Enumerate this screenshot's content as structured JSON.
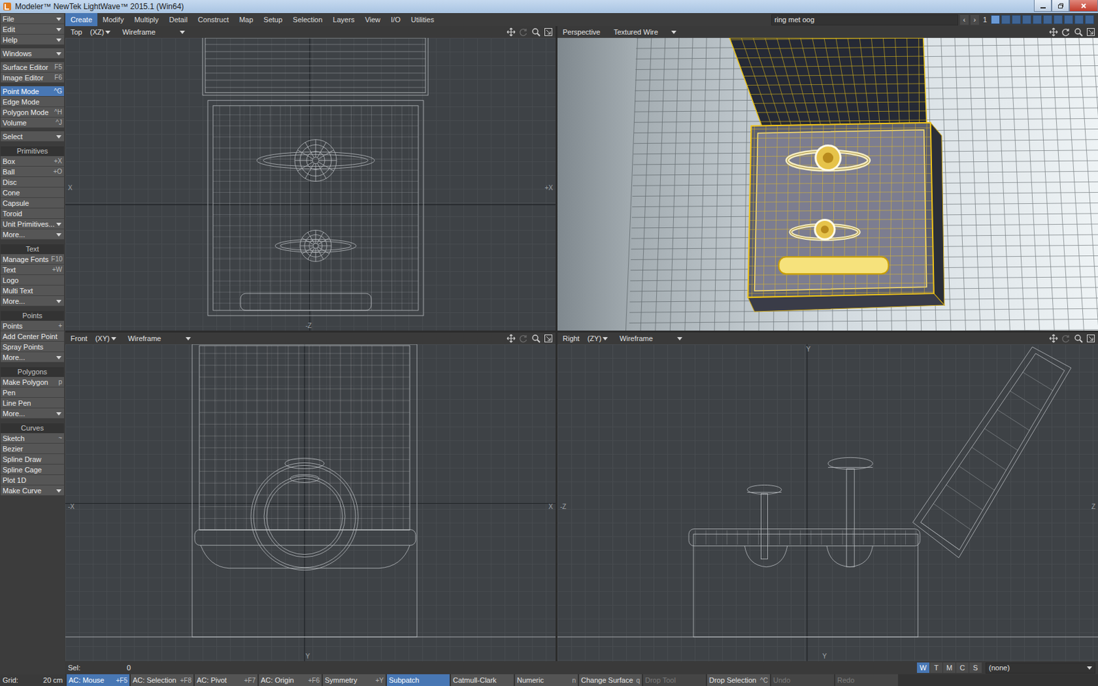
{
  "window": {
    "title": "Modeler™ NewTek LightWave™ 2015.1 (Win64)"
  },
  "tabs": [
    {
      "label": "Create",
      "selected": true
    },
    {
      "label": "Modify",
      "selected": false
    },
    {
      "label": "Multiply",
      "selected": false
    },
    {
      "label": "Detail",
      "selected": false
    },
    {
      "label": "Construct",
      "selected": false
    },
    {
      "label": "Map",
      "selected": false
    },
    {
      "label": "Setup",
      "selected": false
    },
    {
      "label": "Selection",
      "selected": false
    },
    {
      "label": "Layers",
      "selected": false
    },
    {
      "label": "View",
      "selected": false
    },
    {
      "label": "I/O",
      "selected": false
    },
    {
      "label": "Utilities",
      "selected": false
    }
  ],
  "object": {
    "name": "ring met oog",
    "prev": "‹",
    "next": "›",
    "layer": "1",
    "layers": [
      {
        "selected": true
      },
      {
        "selected": false
      },
      {
        "selected": false
      },
      {
        "selected": false
      },
      {
        "selected": false
      },
      {
        "selected": false
      },
      {
        "selected": false
      },
      {
        "selected": false
      },
      {
        "selected": false
      },
      {
        "selected": false
      }
    ]
  },
  "sidebar": {
    "groups": [
      {
        "title": "",
        "items": [
          {
            "label": "File",
            "shortcut": "",
            "kind": "dropdown",
            "selected": false
          },
          {
            "label": "Edit",
            "shortcut": "",
            "kind": "dropdown",
            "selected": false
          },
          {
            "label": "Help",
            "shortcut": "",
            "kind": "dropdown",
            "selected": false
          }
        ]
      },
      {
        "title": "",
        "items": [
          {
            "label": "Windows",
            "shortcut": "",
            "kind": "dropdown",
            "selected": false
          }
        ]
      },
      {
        "title": "",
        "items": [
          {
            "label": "Surface Editor",
            "shortcut": "F5",
            "kind": "button",
            "selected": false
          },
          {
            "label": "Image Editor",
            "shortcut": "F6",
            "kind": "button",
            "selected": false
          }
        ]
      },
      {
        "title": "",
        "items": [
          {
            "label": "Point Mode",
            "shortcut": "^G",
            "kind": "button",
            "selected": true
          },
          {
            "label": "Edge Mode",
            "shortcut": "",
            "kind": "button",
            "selected": false
          },
          {
            "label": "Polygon Mode",
            "shortcut": "^H",
            "kind": "button",
            "selected": false
          },
          {
            "label": "Volume",
            "shortcut": "^J",
            "kind": "button",
            "selected": false
          }
        ]
      },
      {
        "title": "",
        "items": [
          {
            "label": "Select",
            "shortcut": "",
            "kind": "dropdown",
            "selected": false
          }
        ]
      },
      {
        "title": "Primitives",
        "items": [
          {
            "label": "Box",
            "shortcut": "+X",
            "kind": "button",
            "selected": false
          },
          {
            "label": "Ball",
            "shortcut": "+O",
            "kind": "button",
            "selected": false
          },
          {
            "label": "Disc",
            "shortcut": "",
            "kind": "button",
            "selected": false
          },
          {
            "label": "Cone",
            "shortcut": "",
            "kind": "button",
            "selected": false
          },
          {
            "label": "Capsule",
            "shortcut": "",
            "kind": "button",
            "selected": false
          },
          {
            "label": "Toroid",
            "shortcut": "",
            "kind": "button",
            "selected": false
          },
          {
            "label": "Unit Primitives...",
            "shortcut": "",
            "kind": "dropdown",
            "selected": false
          },
          {
            "label": "More...",
            "shortcut": "",
            "kind": "dropdown",
            "selected": false
          }
        ]
      },
      {
        "title": "Text",
        "items": [
          {
            "label": "Manage Fonts",
            "shortcut": "F10",
            "kind": "button",
            "selected": false
          },
          {
            "label": "Text",
            "shortcut": "+W",
            "kind": "button",
            "selected": false
          },
          {
            "label": "Logo",
            "shortcut": "",
            "kind": "button",
            "selected": false
          },
          {
            "label": "Multi Text",
            "shortcut": "",
            "kind": "button",
            "selected": false
          },
          {
            "label": "More...",
            "shortcut": "",
            "kind": "dropdown",
            "selected": false
          }
        ]
      },
      {
        "title": "Points",
        "items": [
          {
            "label": "Points",
            "shortcut": "+",
            "kind": "button",
            "selected": false
          },
          {
            "label": "Add Center Point",
            "shortcut": "",
            "kind": "button",
            "selected": false
          },
          {
            "label": "Spray Points",
            "shortcut": "",
            "kind": "button",
            "selected": false
          },
          {
            "label": "More...",
            "shortcut": "",
            "kind": "dropdown",
            "selected": false
          }
        ]
      },
      {
        "title": "Polygons",
        "items": [
          {
            "label": "Make Polygon",
            "shortcut": "p",
            "kind": "button",
            "selected": false
          },
          {
            "label": "Pen",
            "shortcut": "",
            "kind": "button",
            "selected": false
          },
          {
            "label": "Line Pen",
            "shortcut": "",
            "kind": "button",
            "selected": false
          },
          {
            "label": "More...",
            "shortcut": "",
            "kind": "dropdown",
            "selected": false
          }
        ]
      },
      {
        "title": "Curves",
        "items": [
          {
            "label": "Sketch",
            "shortcut": "~",
            "kind": "button",
            "selected": false
          },
          {
            "label": "Bezier",
            "shortcut": "",
            "kind": "button",
            "selected": false
          },
          {
            "label": "Spline Draw",
            "shortcut": "",
            "kind": "button",
            "selected": false
          },
          {
            "label": "Spline Cage",
            "shortcut": "",
            "kind": "button",
            "selected": false
          },
          {
            "label": "Plot 1D",
            "shortcut": "",
            "kind": "button",
            "selected": false
          },
          {
            "label": "Make Curve",
            "shortcut": "",
            "kind": "dropdown",
            "selected": false
          }
        ]
      }
    ]
  },
  "viewports": [
    {
      "kind": "top",
      "view": "Top",
      "axes": "(XZ)",
      "mode": "Wireframe",
      "labels": {
        "left": "X",
        "right": "+X",
        "bottom": "-Z"
      }
    },
    {
      "kind": "perspective",
      "view": "Perspective",
      "mode": "Textured Wire",
      "labels": {}
    },
    {
      "kind": "front",
      "view": "Front",
      "axes": "(XY)",
      "mode": "Wireframe",
      "labels": {
        "left": "-X",
        "right": "X",
        "bottom": "Y"
      }
    },
    {
      "kind": "right",
      "view": "Right",
      "axes": "(ZY)",
      "mode": "Wireframe",
      "labels": {
        "left": "-Z",
        "right": "Z",
        "top": "Y",
        "bottom": "Y"
      }
    }
  ],
  "selection": {
    "label": "Sel:",
    "count": "0",
    "modes": [
      {
        "label": "W",
        "selected": true
      },
      {
        "label": "T",
        "selected": false
      },
      {
        "label": "M",
        "selected": false
      },
      {
        "label": "C",
        "selected": false
      },
      {
        "label": "S",
        "selected": false
      }
    ],
    "surface": "(none)"
  },
  "status_bar": {
    "grid": {
      "label": "Grid:",
      "value": "20 cm"
    },
    "items": [
      {
        "label": "AC: Mouse",
        "shortcut": "+F5",
        "selected": true,
        "disabled": false
      },
      {
        "label": "AC: Selection",
        "shortcut": "+F8",
        "selected": false,
        "disabled": false
      },
      {
        "label": "AC: Pivot",
        "shortcut": "+F7",
        "selected": false,
        "disabled": false
      },
      {
        "label": "AC: Origin",
        "shortcut": "+F6",
        "selected": false,
        "disabled": false
      },
      {
        "label": "Symmetry",
        "shortcut": "+Y",
        "selected": false,
        "disabled": false
      },
      {
        "label": "Subpatch",
        "shortcut": "",
        "selected": true,
        "disabled": false
      },
      {
        "label": "Catmull-Clark",
        "shortcut": "",
        "selected": false,
        "disabled": false
      },
      {
        "label": "Numeric",
        "shortcut": "n",
        "selected": false,
        "disabled": false
      },
      {
        "label": "Change Surface",
        "shortcut": "q",
        "selected": false,
        "disabled": false
      },
      {
        "label": "Drop Tool",
        "shortcut": "",
        "selected": false,
        "disabled": true
      },
      {
        "label": "Drop Selection",
        "shortcut": "^C",
        "selected": false,
        "disabled": false
      },
      {
        "label": "Undo",
        "shortcut": "",
        "selected": false,
        "disabled": true
      },
      {
        "label": "Redo",
        "shortcut": "",
        "selected": false,
        "disabled": true
      }
    ]
  }
}
